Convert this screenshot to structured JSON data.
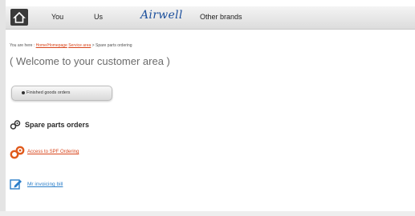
{
  "nav": {
    "home_icon": "home-icon",
    "items": [
      "You",
      "Us",
      "Other brands"
    ],
    "brand": "Airwell"
  },
  "breadcrumb": {
    "prefix": "You are here :",
    "links": [
      "Home/Homepage",
      "Service area"
    ],
    "current": "> Spare parts ordering"
  },
  "page": {
    "welcome": "( Welcome to your customer area )",
    "prev_orders_button": "Finished goods orders",
    "section_title": "Spare parts orders",
    "pdf_link": "Access to SPF Ordering",
    "invoicing_link": "Mr invoicing bill"
  },
  "colors": {
    "link_orange": "#d8451b",
    "link_blue": "#2c7fc9",
    "brand_blue": "#1b4f9c"
  }
}
